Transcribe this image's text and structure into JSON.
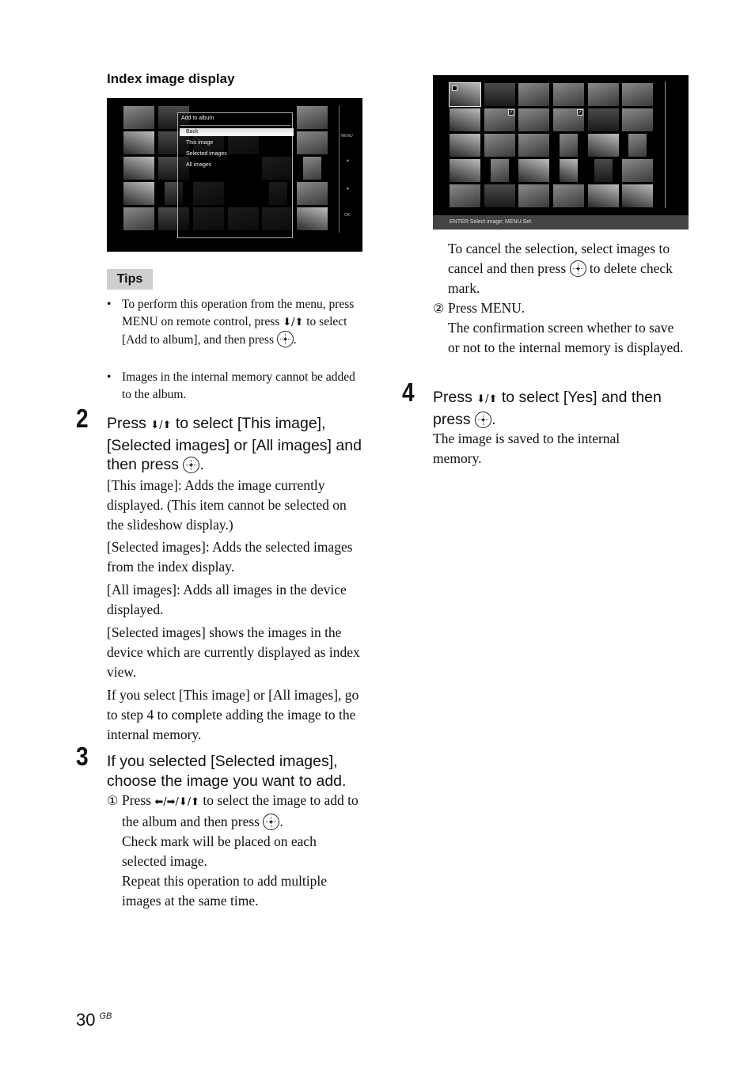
{
  "heading": "Index image display",
  "screen1": {
    "menu_title": "Add to album",
    "menu_items": [
      "Back",
      "This image",
      "Selected images",
      "All images"
    ],
    "selected_index": 0,
    "side_buttons": [
      "MENU",
      "▲",
      "▼",
      "OK"
    ]
  },
  "screen2": {
    "status_text": "ENTER:Select image; MENU:Set."
  },
  "tips": {
    "label": "Tips",
    "items": [
      {
        "before": "To perform this operation from the menu, press MENU on remote control, press ",
        "arrows": "⬇/⬆",
        "after": " to select [Add to album], and then press ",
        "end": "."
      },
      {
        "text": "Images in the internal memory cannot be added to the album."
      }
    ]
  },
  "step2": {
    "number": "2",
    "head_a": "Press ",
    "arrows": "⬇/⬆",
    "head_b": " to select [This image], [Selected images] or [All images] and then press ",
    "head_end": ".",
    "paragraphs": [
      "[This image]: Adds the image currently displayed. (This item cannot be selected on the slideshow display.)",
      "[Selected images]: Adds the selected images from the index display.",
      "[All images]: Adds all images in the device displayed.",
      "[Selected images] shows the images in the device which are currently displayed as index view.",
      "If you select [This image] or [All images], go to step 4 to complete adding the image to the internal memory."
    ]
  },
  "step3": {
    "number": "3",
    "head": "If you selected [Selected images], choose the image you want to add.",
    "sub1_mark": "①",
    "sub1_a": "Press ",
    "sub1_arrows": "⬅/➡/⬇/⬆",
    "sub1_b": " to select the image to add to the album and then press ",
    "sub1_end": ".",
    "sub1_p2": "Check mark will be placed on each selected image.",
    "sub1_p3": "Repeat this operation to add multiple images at the same time.",
    "cancel_a": "To cancel the selection, select images to cancel and then press ",
    "cancel_b": " to delete check mark.",
    "sub2_mark": "②",
    "sub2": "Press MENU.",
    "sub2_p": "The confirmation screen whether to save or not to the internal memory  is displayed."
  },
  "step4": {
    "number": "4",
    "head_a": "Press ",
    "arrows": "⬇/⬆",
    "head_b": " to select [Yes] and then press ",
    "head_end": ".",
    "body": "The image is saved to the internal memory."
  },
  "footer": {
    "page": "30",
    "region": "GB"
  }
}
